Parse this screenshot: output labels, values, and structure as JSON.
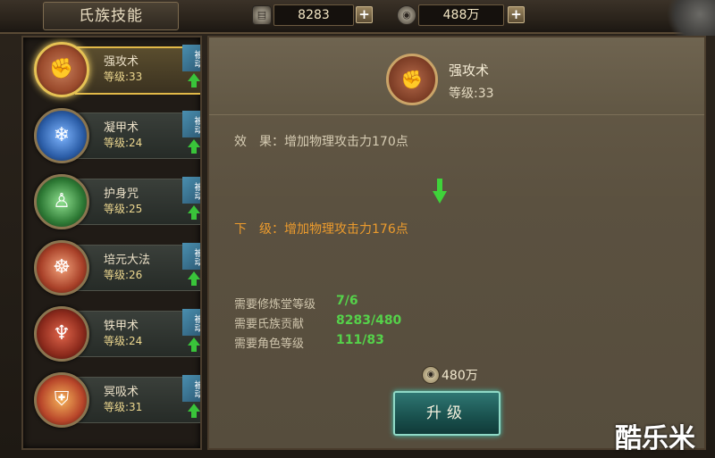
{
  "window": {
    "title": "氏族技能"
  },
  "resources": {
    "contribution": {
      "icon": "scroll-icon",
      "value": "8283",
      "add": "+"
    },
    "money": {
      "icon": "coin-icon",
      "value": "488万",
      "add": "+"
    }
  },
  "skills": [
    {
      "name": "强攻术",
      "level": "等级:33",
      "tag": "被动",
      "icon": "fist-icon",
      "color": "#9a4a2c",
      "selected": true
    },
    {
      "name": "凝甲术",
      "level": "等级:24",
      "tag": "被动",
      "icon": "ice-shield-icon",
      "color": "#2c5ea8"
    },
    {
      "name": "护身咒",
      "level": "等级:25",
      "tag": "被动",
      "icon": "aura-body-icon",
      "color": "#2e7a35"
    },
    {
      "name": "培元大法",
      "level": "等级:26",
      "tag": "被动",
      "icon": "meditation-icon",
      "color": "#a84028"
    },
    {
      "name": "铁甲术",
      "level": "等级:24",
      "tag": "被动",
      "icon": "demon-armor-icon",
      "color": "#8c2a1c"
    },
    {
      "name": "冥吸术",
      "level": "等级:31",
      "tag": "被动",
      "icon": "flame-shield-icon",
      "color": "#b8462a"
    }
  ],
  "detail": {
    "name": "强攻术",
    "level": "等级:33",
    "effect": "效　果：增加物理攻击力170点",
    "next": "下　级：增加物理攻击力176点",
    "requirements": [
      {
        "label": "需要修炼堂等级",
        "value": "7/6"
      },
      {
        "label": "需要氏族贡献",
        "value": "8283/480"
      },
      {
        "label": "需要角色等级",
        "value": "111/83"
      }
    ],
    "cost": "480万",
    "upgrade_label": "升级"
  },
  "watermark": "酷乐米"
}
